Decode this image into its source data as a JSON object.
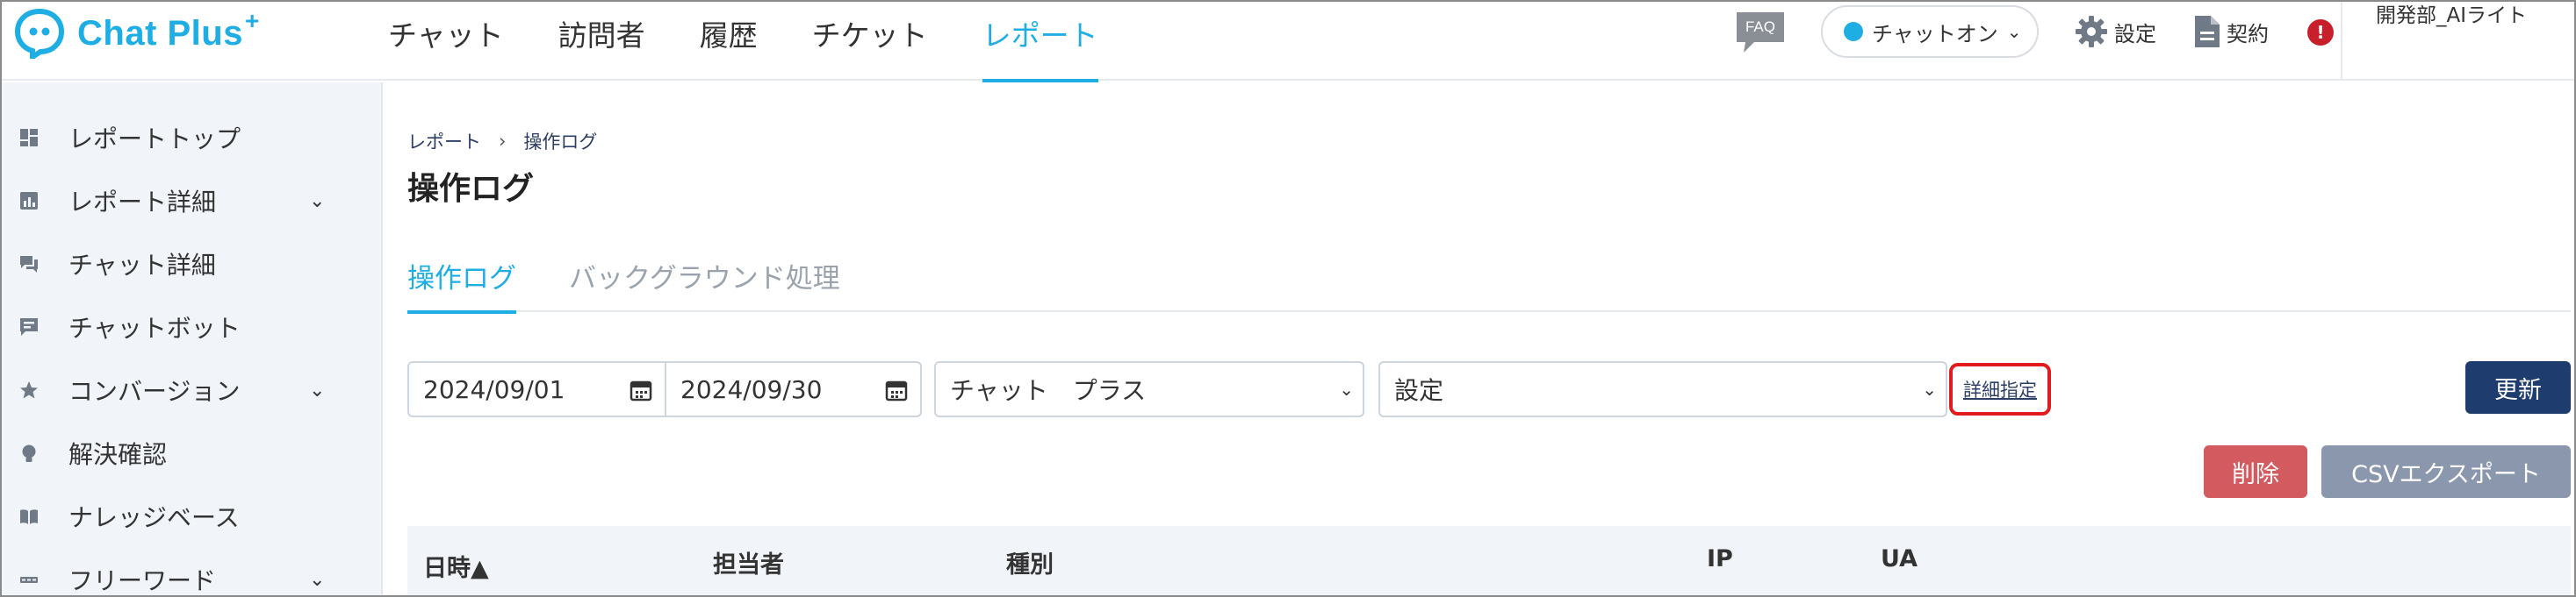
{
  "app": {
    "logo_text": "Chat Plus",
    "logo_plus": "+"
  },
  "nav": {
    "items": [
      {
        "label": "チャット"
      },
      {
        "label": "訪問者"
      },
      {
        "label": "履歴"
      },
      {
        "label": "チケット"
      },
      {
        "label": "レポート"
      }
    ],
    "active_index": 4
  },
  "header": {
    "faq_label": "FAQ",
    "status_label": "チャットオン",
    "settings_label": "設定",
    "contract_label": "契約",
    "alert_glyph": "!",
    "user_name": "開発部_AIライト"
  },
  "sidebar": {
    "items": [
      {
        "label": "レポートトップ",
        "chevron": ""
      },
      {
        "label": "レポート詳細",
        "chevron": "⌄"
      },
      {
        "label": "チャット詳細",
        "chevron": ""
      },
      {
        "label": "チャットボット",
        "chevron": ""
      },
      {
        "label": "コンバージョン",
        "chevron": "⌄"
      },
      {
        "label": "解決確認",
        "chevron": ""
      },
      {
        "label": "ナレッジベース",
        "chevron": ""
      },
      {
        "label": "フリーワード",
        "chevron": "⌄"
      }
    ]
  },
  "breadcrumb": {
    "root": "レポート",
    "separator": "›",
    "current": "操作ログ"
  },
  "page": {
    "title": "操作ログ"
  },
  "tabs": [
    {
      "label": "操作ログ",
      "active": true
    },
    {
      "label": "バックグラウンド処理",
      "active": false
    }
  ],
  "filters": {
    "date_from": "2024/09/01",
    "date_to": "2024/09/30",
    "operator_select": "チャット　プラス",
    "category_select": "設定",
    "detail_link": "詳細指定",
    "chevron": "⌄"
  },
  "buttons": {
    "update": "更新",
    "delete": "削除",
    "csv_export": "CSVエクスポート"
  },
  "table": {
    "headers": [
      {
        "label": "日時▲"
      },
      {
        "label": "担当者"
      },
      {
        "label": "種別"
      },
      {
        "label": "IP"
      },
      {
        "label": "UA"
      }
    ]
  },
  "colors": {
    "accent": "#1eaee4",
    "navy": "#1f3c6e",
    "danger": "#d35a5f",
    "highlight": "#e01c1c"
  }
}
